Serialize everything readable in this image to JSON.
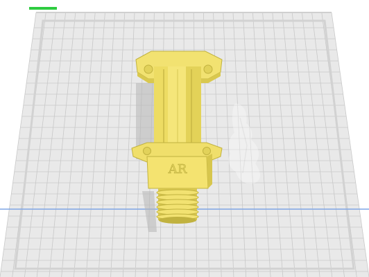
{
  "viewport": {
    "title": "",
    "background": "#ffffff"
  },
  "progress": {
    "fraction": 1.0,
    "color": "#2ecc40"
  },
  "build_plate": {
    "plate_color": "#e9e9e9",
    "grid_color": "#c8c8c8",
    "border_color": "#d2d2d2",
    "axis_line_color": "#7fa6e6"
  },
  "model": {
    "name": "",
    "color": "#f2e271",
    "shade_color": "#d9c84f",
    "dark_color": "#c1b23f",
    "label": "AR"
  },
  "shadow": {
    "color": "#b7b7b7"
  },
  "icons": {
    "watermark": "print-head-silhouette-icon"
  }
}
